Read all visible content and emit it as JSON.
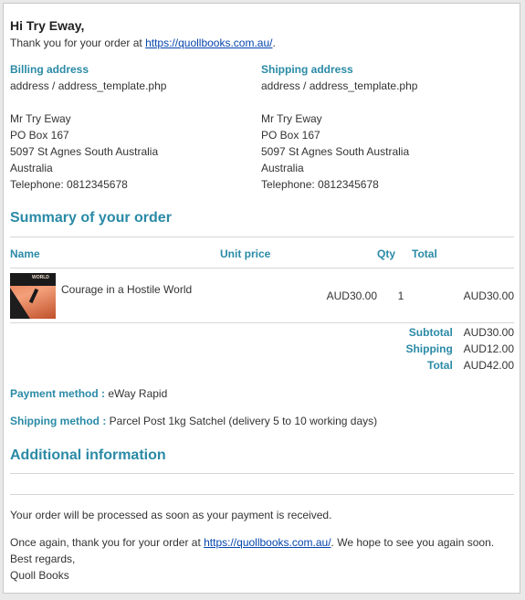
{
  "greeting": "Hi Try Eway,",
  "thanks_prefix": "Thank you for your order at ",
  "site_link": "https://quollbooks.com.au/",
  "thanks_suffix": ".",
  "billing": {
    "heading": "Billing address",
    "template": "address / address_template.php",
    "lines": [
      "Mr Try Eway",
      "PO Box 167",
      "5097 St Agnes South Australia",
      "Australia",
      "Telephone: 0812345678"
    ]
  },
  "shipping_addr": {
    "heading": "Shipping address",
    "template": "address / address_template.php",
    "lines": [
      "Mr Try Eway",
      "PO Box 167",
      "5097 St Agnes South Australia",
      "Australia",
      "Telephone: 0812345678"
    ]
  },
  "summary": {
    "title": "Summary of your order",
    "headers": {
      "name": "Name",
      "unit_price": "Unit price",
      "qty": "Qty",
      "total": "Total"
    },
    "item": {
      "thumb_text": "WORLD",
      "name": "Courage in a Hostile World",
      "unit_price": "AUD30.00",
      "qty": "1",
      "total": "AUD30.00"
    },
    "subtotal_label": "Subtotal",
    "subtotal": "AUD30.00",
    "shipping_label": "Shipping",
    "shipping": "AUD12.00",
    "total_label": "Total",
    "total": "AUD42.00"
  },
  "payment": {
    "label": "Payment method :",
    "value": "eWay Rapid"
  },
  "shipping_method": {
    "label": "Shipping method :",
    "value": "Parcel Post 1kg Satchel (delivery 5 to 10 working days)"
  },
  "additional": {
    "title": "Additional information"
  },
  "footer": {
    "processed": "Your order will be processed as soon as your payment is received.",
    "again_prefix": "Once again, thank you for your order at ",
    "again_link": "https://quollbooks.com.au/",
    "again_suffix": ". We hope to see you again soon.",
    "regards": "Best regards,",
    "signature": "Quoll Books"
  },
  "colors": {
    "accent": "#2a8aa6",
    "link": "#0645ad",
    "text": "#333333"
  }
}
